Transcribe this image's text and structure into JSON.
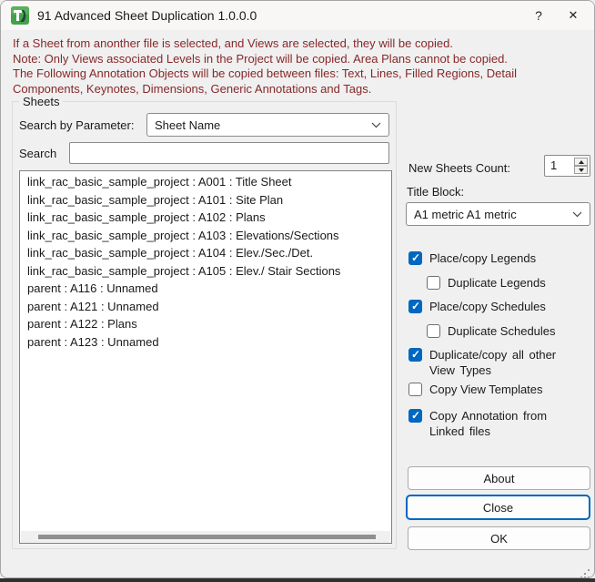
{
  "window": {
    "title": "91 Advanced Sheet Duplication 1.0.0.0",
    "help_label": "?",
    "close_label": "✕"
  },
  "intro": {
    "line1": "If a Sheet from anonther file is selected, and Views are selected, they will be copied.",
    "line2": "Note: Only Views associated Levels in the Project will be copied. Area Plans cannot be copied.",
    "line3": "The Following Annotation Objects will be copied between files: Text, Lines, Filled Regions, Detail Components, Keynotes, Dimensions, Generic Annotations and Tags."
  },
  "sheets_group": {
    "title": "Sheets",
    "search_by_parameter_label": "Search by Parameter:",
    "search_by_parameter_value": "Sheet Name",
    "search_label": "Search",
    "search_value": "",
    "sheet_list": [
      "link_rac_basic_sample_project : A001 : Title Sheet",
      "link_rac_basic_sample_project : A101 : Site Plan",
      "link_rac_basic_sample_project : A102 : Plans",
      "link_rac_basic_sample_project : A103 : Elevations/Sections",
      "link_rac_basic_sample_project : A104 : Elev./Sec./Det.",
      "link_rac_basic_sample_project : A105 : Elev./ Stair Sections",
      "parent : A116 : Unnamed",
      "parent : A121 : Unnamed",
      "parent : A122 : Plans",
      "parent : A123 : Unnamed"
    ]
  },
  "options": {
    "new_sheets_count_label": "New Sheets Count:",
    "new_sheets_count_value": "1",
    "title_block_label": "Title Block:",
    "title_block_value": "A1 metric A1 metric",
    "checkboxes": [
      {
        "label": "Place/copy Legends",
        "checked": true,
        "indent": 0
      },
      {
        "label": "Duplicate Legends",
        "checked": false,
        "indent": 1
      },
      {
        "label": "Place/copy Schedules",
        "checked": true,
        "indent": 0
      },
      {
        "label": "Duplicate Schedules",
        "checked": false,
        "indent": 1
      },
      {
        "label": "Duplicate/copy all other View Types",
        "checked": true,
        "indent": 0
      },
      {
        "label": "Copy View Templates",
        "checked": false,
        "indent": 0
      },
      {
        "label": "Copy Annotation from Linked files",
        "checked": true,
        "indent": 0
      }
    ]
  },
  "buttons": {
    "about": "About",
    "close": "Close",
    "ok": "OK"
  },
  "colors": {
    "accent": "#0067C0",
    "warning_text": "#86282a",
    "checkbox_checked": "#0067C0"
  }
}
